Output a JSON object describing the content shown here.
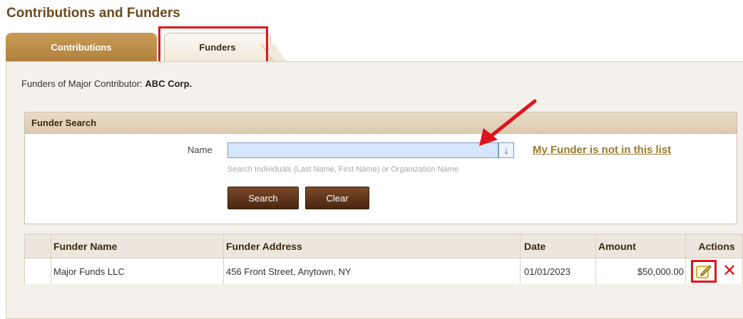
{
  "page": {
    "title": "Contributions and Funders"
  },
  "tabs": [
    {
      "label": "Contributions"
    },
    {
      "label": "Funders"
    }
  ],
  "funders_of": {
    "prefix": "Funders of Major Contributor:",
    "contributor": "ABC Corp."
  },
  "funder_search": {
    "header": "Funder Search",
    "name_label": "Name",
    "name_value": "",
    "hint": "Search Individuals (Last Name, First Name) or Organization Name",
    "not_in_list_link": "My Funder is not in this list",
    "search_button": "Search",
    "clear_button": "Clear"
  },
  "table": {
    "headers": [
      "Funder Name",
      "Funder Address",
      "Date",
      "Amount",
      "Actions"
    ],
    "rows": [
      {
        "name": "Major Funds LLC",
        "address": "456 Front Street, Anytown, NY",
        "date": "01/01/2023",
        "amount": "$50,000.00"
      }
    ]
  },
  "colors": {
    "title": "#6b4a20",
    "tab_active_bg": "#b0823f",
    "button_bg": "#5a3218",
    "annotation": "#e0141c",
    "link": "#9a7a2f",
    "input_bg": "#d6e6fa"
  },
  "icons": [
    "chevron-down-icon",
    "edit-icon",
    "delete-icon",
    "annotation-arrow"
  ]
}
